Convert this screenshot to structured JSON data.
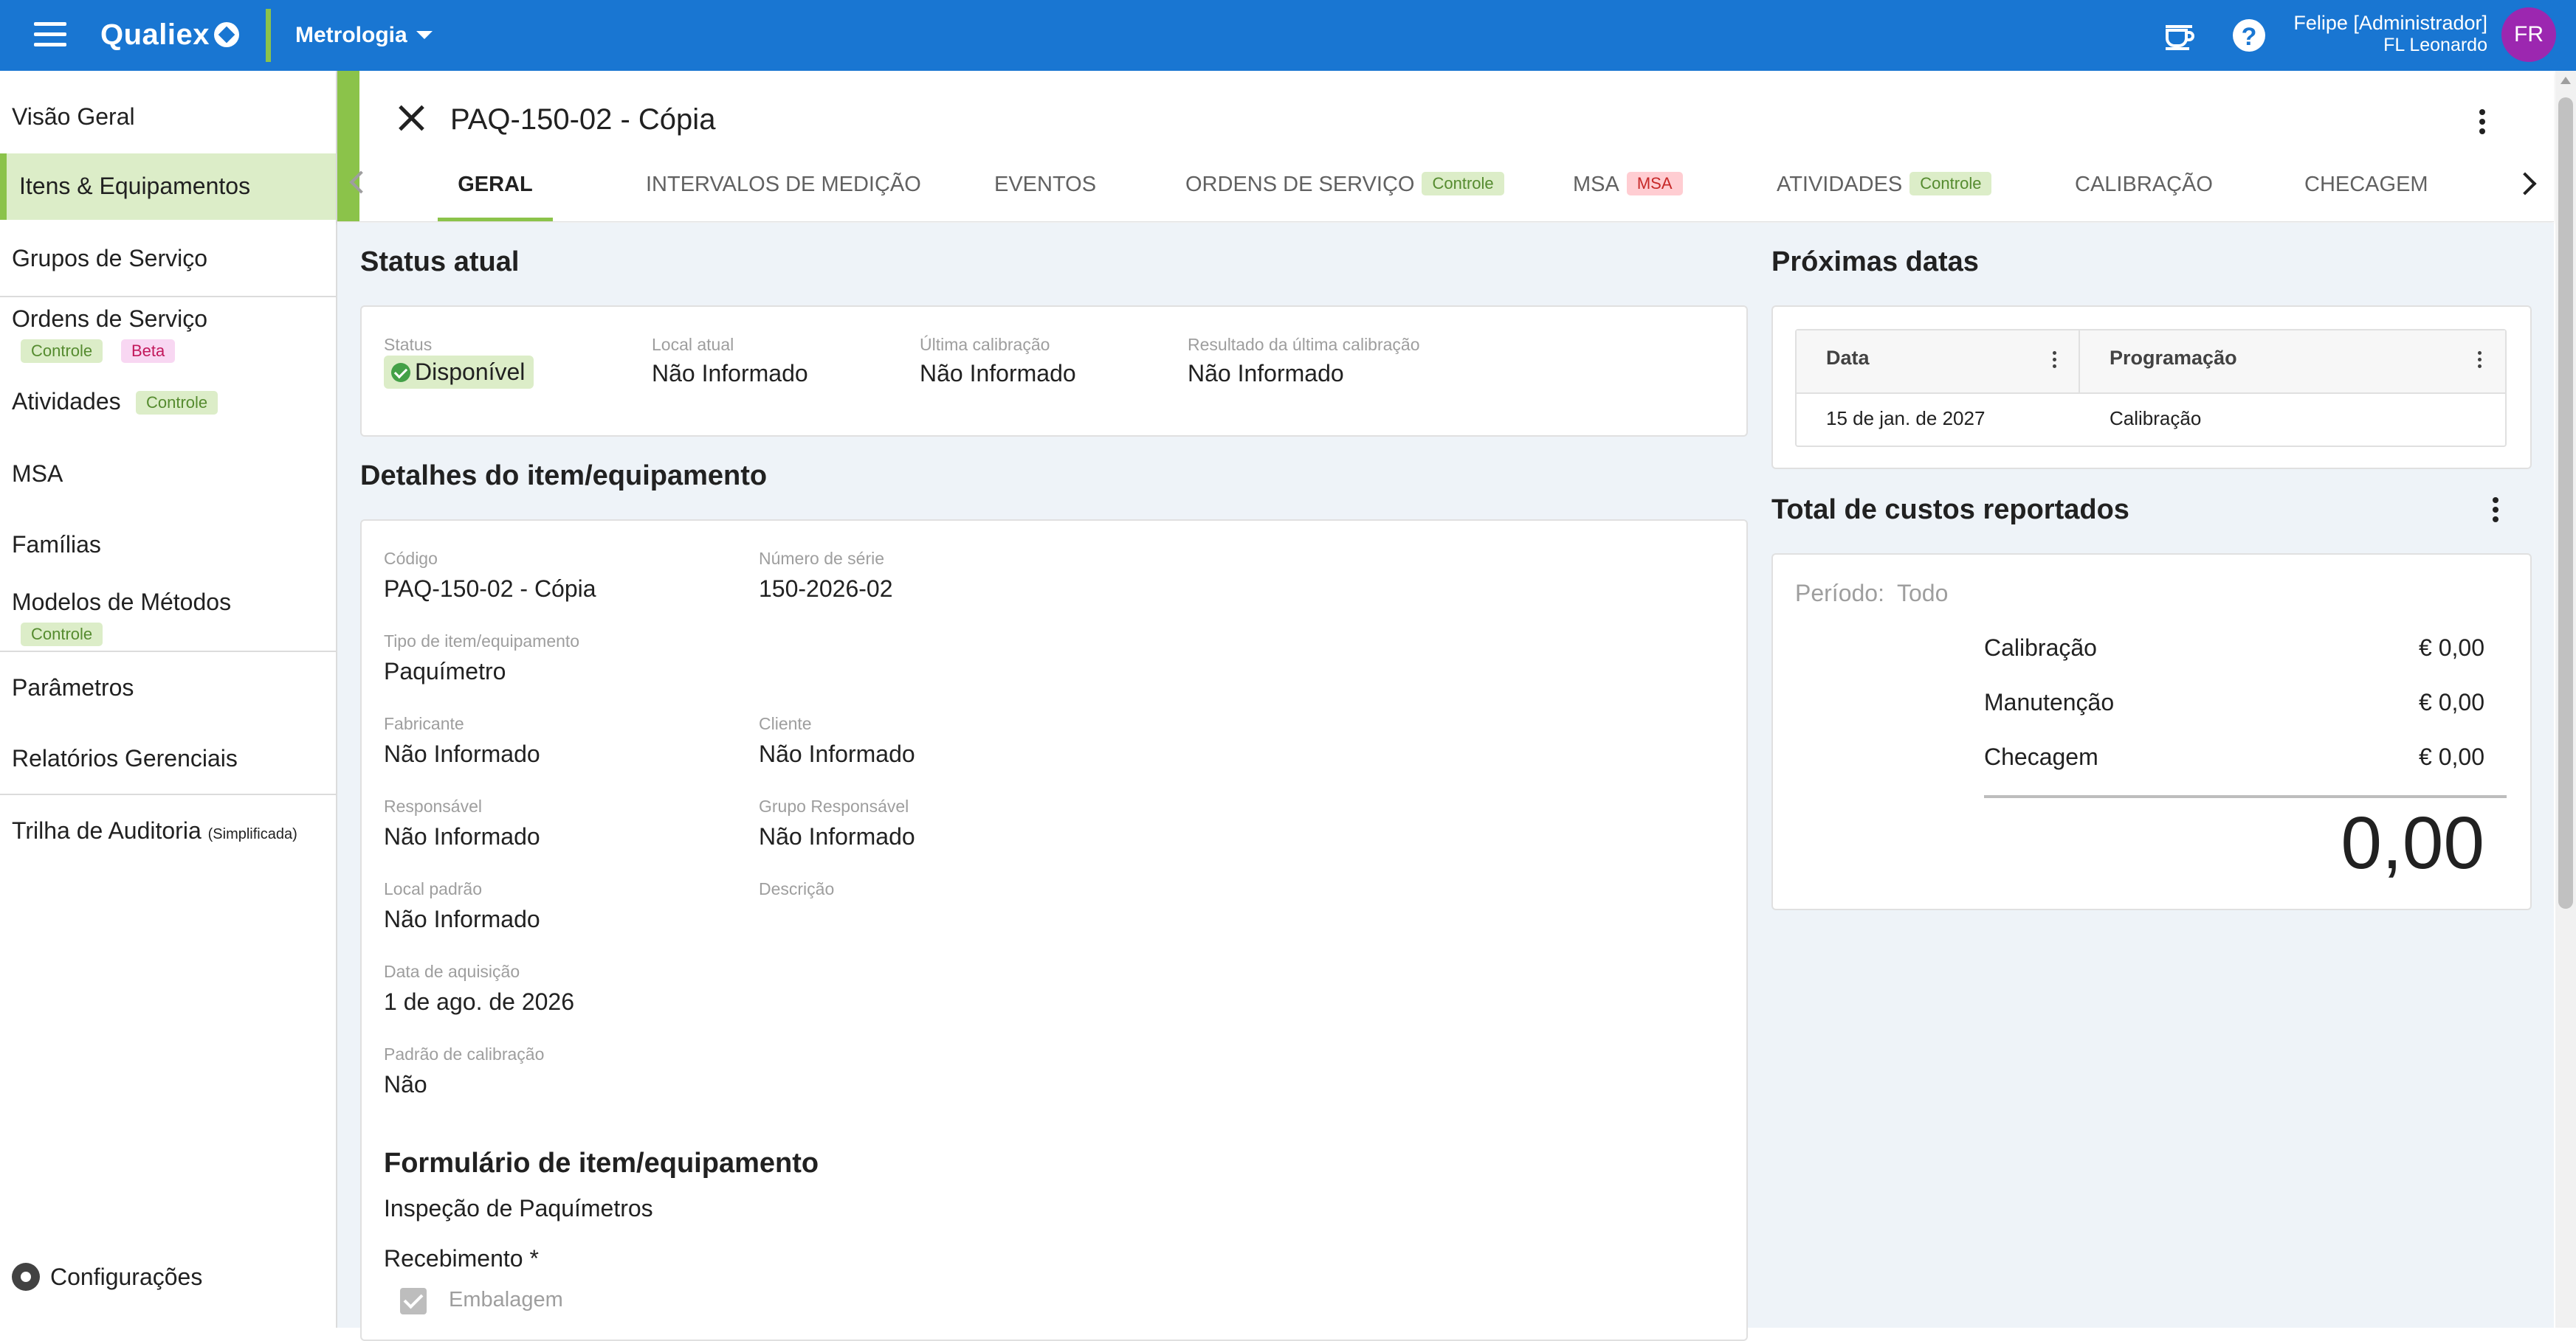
{
  "topbar": {
    "logo": "Qualiex",
    "module": "Metrologia",
    "user_name": "Felipe [Administrador]",
    "user_company": "FL Leonardo",
    "avatar_initials": "FR",
    "help_glyph": "?",
    "colors": {
      "bar": "#1976d2",
      "accent": "#8bc34a",
      "avatar": "#9c27b0"
    }
  },
  "sidebar": {
    "items": [
      {
        "label": "Visão Geral"
      },
      {
        "label": "Itens & Equipamentos",
        "active": true
      },
      {
        "label": "Grupos de Serviço"
      },
      {
        "label": "Ordens de Serviço",
        "chips": [
          "Controle",
          "Beta"
        ]
      },
      {
        "label": "Atividades",
        "chips": [
          "Controle"
        ]
      },
      {
        "label": "MSA"
      },
      {
        "label": "Famílias"
      },
      {
        "label": "Modelos de Métodos",
        "chips": [
          "Controle"
        ]
      },
      {
        "label": "Parâmetros"
      },
      {
        "label": "Relatórios Gerenciais"
      },
      {
        "label": "Trilha de Auditoria",
        "note": "(Simplificada)"
      }
    ],
    "settings_label": "Configurações"
  },
  "header": {
    "title": "PAQ-150-02 - Cópia",
    "tabs": [
      {
        "label": "GERAL",
        "active": true
      },
      {
        "label": "INTERVALOS DE MEDIÇÃO"
      },
      {
        "label": "EVENTOS"
      },
      {
        "label": "ORDENS DE SERVIÇO",
        "chip": "Controle"
      },
      {
        "label": "MSA",
        "chip": "MSA"
      },
      {
        "label": "ATIVIDADES",
        "chip": "Controle"
      },
      {
        "label": "CALIBRAÇÃO"
      },
      {
        "label": "CHECAGEM"
      }
    ]
  },
  "status": {
    "section_title": "Status atual",
    "fields": [
      {
        "label": "Status",
        "value": "Disponível"
      },
      {
        "label": "Local atual",
        "value": "Não Informado"
      },
      {
        "label": "Última calibração",
        "value": "Não Informado"
      },
      {
        "label": "Resultado da última calibração",
        "value": "Não Informado"
      }
    ]
  },
  "details": {
    "section_title": "Detalhes do item/equipamento",
    "fields": [
      {
        "label": "Código",
        "value": "PAQ-150-02 - Cópia"
      },
      {
        "label": "Número de série",
        "value": "150-2026-02"
      },
      {
        "label": "Tipo de item/equipamento",
        "value": "Paquímetro"
      },
      {
        "label": "Fabricante",
        "value": "Não Informado"
      },
      {
        "label": "Cliente",
        "value": "Não Informado"
      },
      {
        "label": "Responsável",
        "value": "Não Informado"
      },
      {
        "label": "Grupo Responsável",
        "value": "Não Informado"
      },
      {
        "label": "Local padrão",
        "value": "Não Informado"
      },
      {
        "label": "Descrição",
        "value": ""
      },
      {
        "label": "Data de aquisição",
        "value": "1 de ago. de 2026"
      },
      {
        "label": "Padrão de calibração",
        "value": "Não"
      }
    ],
    "form_title": "Formulário de item/equipamento",
    "form_name": "Inspeção de Paquímetros",
    "form_section": "Recebimento *",
    "form_checkbox_label": "Embalagem",
    "form_checkbox_checked": true
  },
  "next_dates": {
    "section_title": "Próximas datas",
    "columns": [
      "Data",
      "Programação"
    ],
    "rows": [
      {
        "date": "15 de jan. de 2027",
        "schedule": "Calibração"
      }
    ]
  },
  "costs": {
    "section_title": "Total de custos reportados",
    "period_label": "Período:",
    "period_value": "Todo",
    "lines": [
      {
        "label": "Calibração",
        "value": "€ 0,00"
      },
      {
        "label": "Manutenção",
        "value": "€ 0,00"
      },
      {
        "label": "Checagem",
        "value": "€ 0,00"
      }
    ],
    "total": "0,00"
  }
}
